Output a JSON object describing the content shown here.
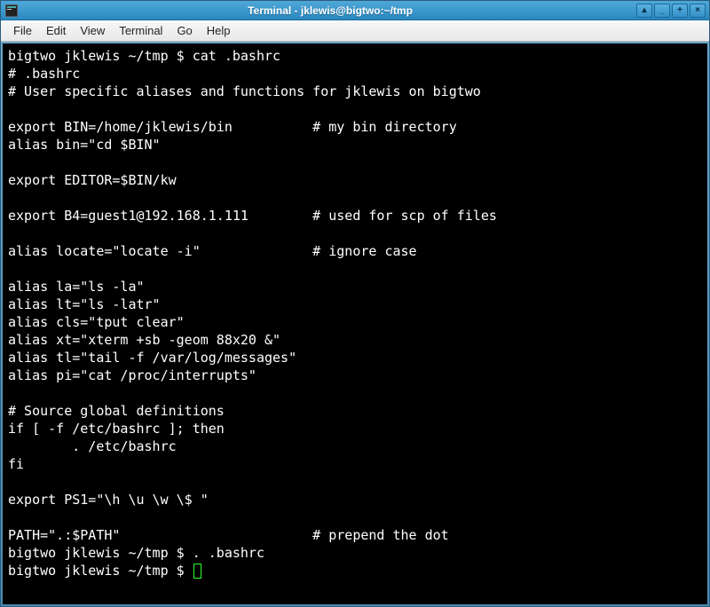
{
  "window": {
    "title": "Terminal - jklewis@bigtwo:~/tmp"
  },
  "menubar": {
    "items": [
      "File",
      "Edit",
      "View",
      "Terminal",
      "Go",
      "Help"
    ]
  },
  "terminal": {
    "lines": [
      "bigtwo jklewis ~/tmp $ cat .bashrc",
      "# .bashrc",
      "# User specific aliases and functions for jklewis on bigtwo",
      "",
      "export BIN=/home/jklewis/bin          # my bin directory",
      "alias bin=\"cd $BIN\"",
      "",
      "export EDITOR=$BIN/kw",
      "",
      "export B4=guest1@192.168.1.111        # used for scp of files",
      "",
      "alias locate=\"locate -i\"              # ignore case",
      "",
      "alias la=\"ls -la\"",
      "alias lt=\"ls -latr\"",
      "alias cls=\"tput clear\"",
      "alias xt=\"xterm +sb -geom 88x20 &\"",
      "alias tl=\"tail -f /var/log/messages\"",
      "alias pi=\"cat /proc/interrupts\"",
      "",
      "# Source global definitions",
      "if [ -f /etc/bashrc ]; then",
      "        . /etc/bashrc",
      "fi",
      "",
      "export PS1=\"\\h \\u \\w \\$ \"",
      "",
      "PATH=\".:$PATH\"                        # prepend the dot",
      "bigtwo jklewis ~/tmp $ . .bashrc"
    ],
    "prompt_final": "bigtwo jklewis ~/tmp $ "
  },
  "controls": {
    "shade": "▴",
    "min": "_",
    "max": "+",
    "close": "×"
  }
}
